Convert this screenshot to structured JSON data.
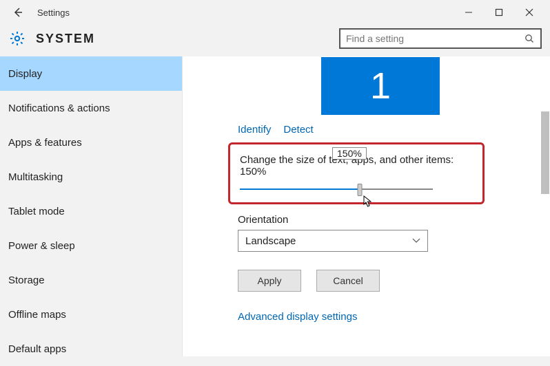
{
  "window": {
    "title": "Settings"
  },
  "header": {
    "title": "SYSTEM",
    "search_placeholder": "Find a setting"
  },
  "sidebar": {
    "items": [
      {
        "label": "Display",
        "active": true
      },
      {
        "label": "Notifications & actions",
        "active": false
      },
      {
        "label": "Apps & features",
        "active": false
      },
      {
        "label": "Multitasking",
        "active": false
      },
      {
        "label": "Tablet mode",
        "active": false
      },
      {
        "label": "Power & sleep",
        "active": false
      },
      {
        "label": "Storage",
        "active": false
      },
      {
        "label": "Offline maps",
        "active": false
      },
      {
        "label": "Default apps",
        "active": false
      }
    ]
  },
  "display": {
    "monitor_number": "1",
    "identify_label": "Identify",
    "detect_label": "Detect",
    "scale_tooltip": "150%",
    "scale_label_full": "Change the size of text, apps, and other items: 150%",
    "scale_percent": 150,
    "orientation_label": "Orientation",
    "orientation_value": "Landscape",
    "apply_label": "Apply",
    "cancel_label": "Cancel",
    "advanced_link": "Advanced display settings"
  }
}
